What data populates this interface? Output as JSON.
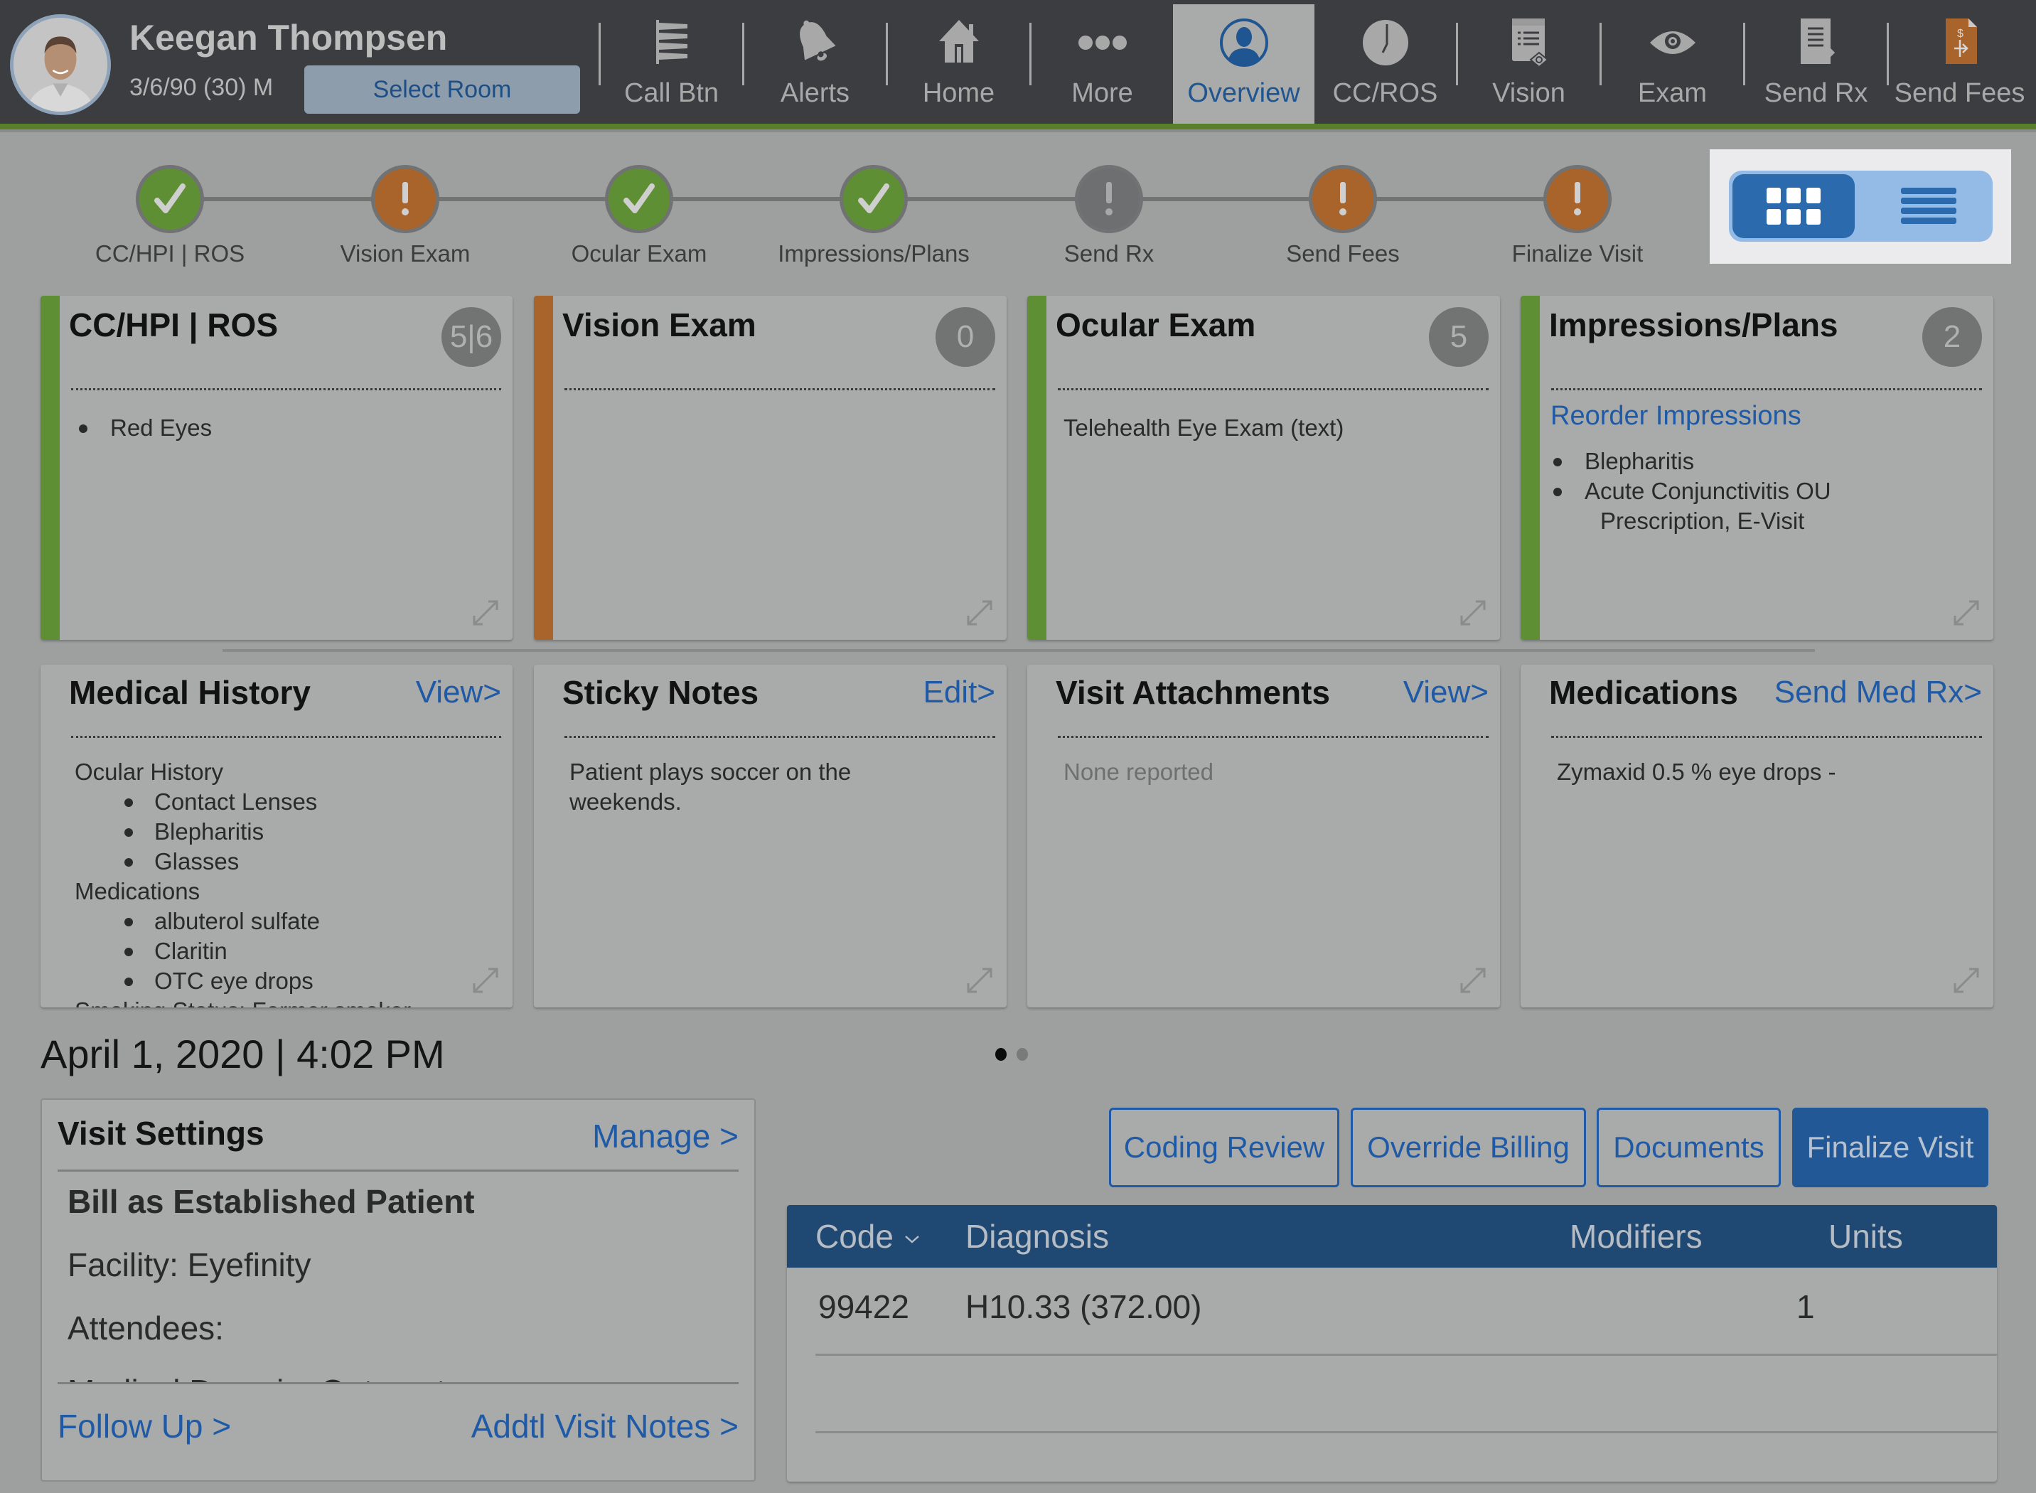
{
  "patient": {
    "name": "Keegan Thompsen",
    "dob_age_sex": "3/6/90 (30) M",
    "select_room_label": "Select Room"
  },
  "nav": {
    "items": [
      {
        "label": "Call Btn",
        "icon": "call-button-icon",
        "active": false
      },
      {
        "label": "Alerts",
        "icon": "bell-icon",
        "active": false
      },
      {
        "label": "Home",
        "icon": "home-icon",
        "active": false
      },
      {
        "label": "More",
        "icon": "more-dots-icon",
        "active": false
      },
      {
        "label": "Overview",
        "icon": "person-icon",
        "active": true
      },
      {
        "label": "CC/ROS",
        "icon": "clock-icon",
        "active": false
      },
      {
        "label": "Vision",
        "icon": "vision-document-icon",
        "active": false
      },
      {
        "label": "Exam",
        "icon": "eye-icon",
        "active": false
      },
      {
        "label": "Send Rx",
        "icon": "send-rx-document-icon",
        "active": false
      },
      {
        "label": "Send Fees",
        "icon": "send-fees-document-icon",
        "active": false
      }
    ]
  },
  "progress": {
    "steps": [
      {
        "label": "CC/HPI | ROS",
        "status": "complete"
      },
      {
        "label": "Vision Exam",
        "status": "warning"
      },
      {
        "label": "Ocular Exam",
        "status": "complete"
      },
      {
        "label": "Impressions/Plans",
        "status": "complete"
      },
      {
        "label": "Send Rx",
        "status": "inactive"
      },
      {
        "label": "Send Fees",
        "status": "warning"
      },
      {
        "label": "Finalize Visit",
        "status": "warning"
      }
    ]
  },
  "view_toggle": {
    "selected": "grid",
    "options": [
      "grid-view-icon",
      "list-view-icon"
    ]
  },
  "cards_row1": [
    {
      "title": "CC/HPI | ROS",
      "badge": "5|6",
      "accent": "#5f8f34",
      "items": [
        "Red Eyes"
      ]
    },
    {
      "title": "Vision Exam",
      "badge": "0",
      "accent": "#a8642a",
      "items": []
    },
    {
      "title": "Ocular Exam",
      "badge": "5",
      "accent": "#5f8f34",
      "text": "Telehealth Eye Exam (text)"
    },
    {
      "title": "Impressions/Plans",
      "badge": "2",
      "accent": "#5f8f34",
      "link": "Reorder Impressions",
      "items": [
        "Blepharitis",
        "Acute Conjunctivitis OU"
      ],
      "subtext": "Prescription, E-Visit"
    }
  ],
  "cards_row2": {
    "medical_history": {
      "title": "Medical History",
      "link": "View>",
      "sections": [
        {
          "heading": "Ocular History",
          "items": [
            "Contact Lenses",
            "Blepharitis",
            "Glasses"
          ]
        },
        {
          "heading": "Medications",
          "items": [
            "albuterol sulfate",
            "Claritin",
            "OTC eye drops"
          ]
        }
      ],
      "cutoff_line": "Smoking Status: Former smoker"
    },
    "sticky_notes": {
      "title": "Sticky Notes",
      "link": "Edit>",
      "text": "Patient plays soccer on the weekends."
    },
    "visit_attachments": {
      "title": "Visit Attachments",
      "link": "View>",
      "text": "None reported"
    },
    "medications": {
      "title": "Medications",
      "link": "Send Med Rx>",
      "text": "Zymaxid 0.5 % eye drops -"
    }
  },
  "visit": {
    "datetime": "April 1, 2020 | 4:02 PM",
    "page_dots": {
      "total": 2,
      "active": 1
    }
  },
  "visit_settings": {
    "title": "Visit Settings",
    "manage_label": "Manage >",
    "rows": [
      {
        "text": "Bill as Established Patient",
        "bold": true
      },
      {
        "text": "Facility: Eyefinity",
        "bold": false
      },
      {
        "text": "Attendees:",
        "bold": false
      },
      {
        "text": "Medical Domain: Optometry",
        "bold": false
      }
    ],
    "follow_up_label": "Follow Up >",
    "addtl_notes_label": "Addtl Visit Notes >"
  },
  "actions": {
    "coding_review": "Coding Review",
    "override_billing": "Override Billing",
    "documents": "Documents",
    "finalize_visit": "Finalize Visit"
  },
  "code_table": {
    "columns": [
      "Code",
      "Diagnosis",
      "Modifiers",
      "Units"
    ],
    "rows": [
      {
        "code": "99422",
        "diagnosis": "H10.33 (372.00)",
        "modifiers": "",
        "units": "1"
      }
    ]
  }
}
